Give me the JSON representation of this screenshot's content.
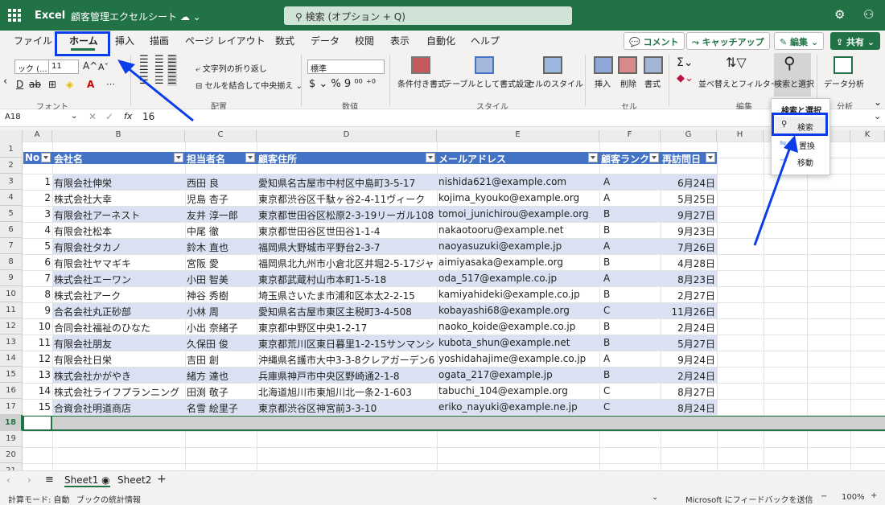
{
  "app": {
    "name": "Excel",
    "doc_title": "顧客管理エクセルシート",
    "search": "検索 (オプション + Q)"
  },
  "tabs": [
    "ファイル",
    "ホーム",
    "挿入",
    "描画",
    "ページ レイアウト",
    "数式",
    "データ",
    "校閲",
    "表示",
    "自動化",
    "ヘルプ"
  ],
  "top_buttons": {
    "comment": "コメント",
    "catchup": "キャッチアップ",
    "edit": "編集",
    "share": "共有"
  },
  "ribbon": {
    "font_name": "ック (...",
    "font_size": "11",
    "font_group": "フォント",
    "wrap": "文字列の折り返し",
    "merge": "セルを結合して中央揃え",
    "align_group": "配置",
    "number_format": "標準",
    "number_group": "数値",
    "cond": "条件付き書式",
    "table": "テーブルとして書式設定",
    "cellstyle": "セルのスタイル",
    "style_group": "スタイル",
    "insert": "挿入",
    "delete": "削除",
    "format": "書式",
    "cell_group": "セル",
    "sort": "並べ替えとフィルター",
    "find": "検索と選択",
    "edit_group": "編集",
    "analyze": "データ分析",
    "analyze_group": "分析"
  },
  "formula": {
    "namebox": "A18",
    "value": "16"
  },
  "columns": [
    "A",
    "B",
    "C",
    "D",
    "E",
    "F",
    "G",
    "H",
    "I",
    "J",
    "K"
  ],
  "header": [
    "No",
    "会社名",
    "担当者名",
    "顧客住所",
    "メールアドレス",
    "顧客ランク",
    "再訪問日"
  ],
  "rows": [
    [
      "1",
      "有限会社伸栄",
      "西田 良",
      "愛知県名古屋市中村区中島町3-5-17",
      "nishida621@example.com",
      "A",
      "6月24日"
    ],
    [
      "2",
      "株式会社大幸",
      "児島 杏子",
      "東京都渋谷区千駄ヶ谷2-4-11ヴィーク",
      "kojima_kyouko@example.org",
      "A",
      "5月25日"
    ],
    [
      "3",
      "有限会社アーネスト",
      "友井 淳一郎",
      "東京都世田谷区松原2-3-19リーガル108",
      "tomoi_junichirou@example.org",
      "B",
      "9月27日"
    ],
    [
      "4",
      "有限会社松本",
      "中尾 徹",
      "東京都世田谷区世田谷1-1-4",
      "nakaotooru@example.net",
      "B",
      "9月23日"
    ],
    [
      "5",
      "有限会社タカノ",
      "鈴木 直也",
      "福岡県大野城市平野台2-3-7",
      "naoyasuzuki@example.jp",
      "A",
      "7月26日"
    ],
    [
      "6",
      "有限会社ヤマギキ",
      "宮阪 愛",
      "福岡県北九州市小倉北区井堀2-5-17ジャ",
      "aimiyasaka@example.org",
      "B",
      "4月28日"
    ],
    [
      "7",
      "株式会社エーワン",
      "小田 智美",
      "東京都武蔵村山市本町1-5-18",
      "oda_517@example.co.jp",
      "A",
      "8月23日"
    ],
    [
      "8",
      "株式会社アーク",
      "神谷 秀樹",
      "埼玉県さいたま市浦和区本太2-2-15",
      "kamiyahideki@example.co.jp",
      "B",
      "2月27日"
    ],
    [
      "9",
      "合名会社丸正砂部",
      "小林 周",
      "愛知県名古屋市東区主税町3-4-508",
      "kobayashi68@example.org",
      "C",
      "11月26日"
    ],
    [
      "10",
      "合同会社福祉のひなた",
      "小出 奈緒子",
      "東京都中野区中央1-2-17",
      "naoko_koide@example.co.jp",
      "B",
      "2月24日"
    ],
    [
      "11",
      "有限会社朋友",
      "久保田 俊",
      "東京都荒川区東日暮里1-2-15サンマンシ",
      "kubota_shun@example.net",
      "B",
      "5月27日"
    ],
    [
      "12",
      "有限会社日栄",
      "吉田 創",
      "沖縄県名護市大中3-3-8クレアガーデン6",
      "yoshidahajime@example.co.jp",
      "A",
      "9月24日"
    ],
    [
      "13",
      "株式会社かがやき",
      "緒方 達也",
      "兵庫県神戸市中央区野崎通2-1-8",
      "ogata_217@example.jp",
      "B",
      "2月24日"
    ],
    [
      "14",
      "株式会社ライフプランニング",
      "田渕 敬子",
      "北海道旭川市東旭川北一条2-1-603",
      "tabuchi_104@example.org",
      "C",
      "8月27日"
    ],
    [
      "15",
      "合資会社明道商店",
      "名雪 絵里子",
      "東京都渋谷区神宮前3-3-10",
      "eriko_nayuki@example.ne.jp",
      "C",
      "8月24日"
    ]
  ],
  "rownums": [
    "1",
    "2",
    "3",
    "4",
    "5",
    "6",
    "7",
    "8",
    "9",
    "10",
    "11",
    "12",
    "13",
    "14",
    "15",
    "16",
    "17",
    "18",
    "19",
    "20",
    "21"
  ],
  "dropdown": {
    "title": "検索と選択",
    "search": "検索",
    "replace": "置換",
    "goto": "移動"
  },
  "sheets": [
    "Sheet1",
    "Sheet2"
  ],
  "status": {
    "mode": "計算モード: 自動",
    "stats": "ブックの統計情報",
    "feedback": "Microsoft にフィードバックを送信",
    "zoom": "100%"
  },
  "colors": {
    "accent": "#217346",
    "table_header": "#4472c4",
    "band": "#d9e1f2",
    "annotation": "#0b3de8"
  }
}
